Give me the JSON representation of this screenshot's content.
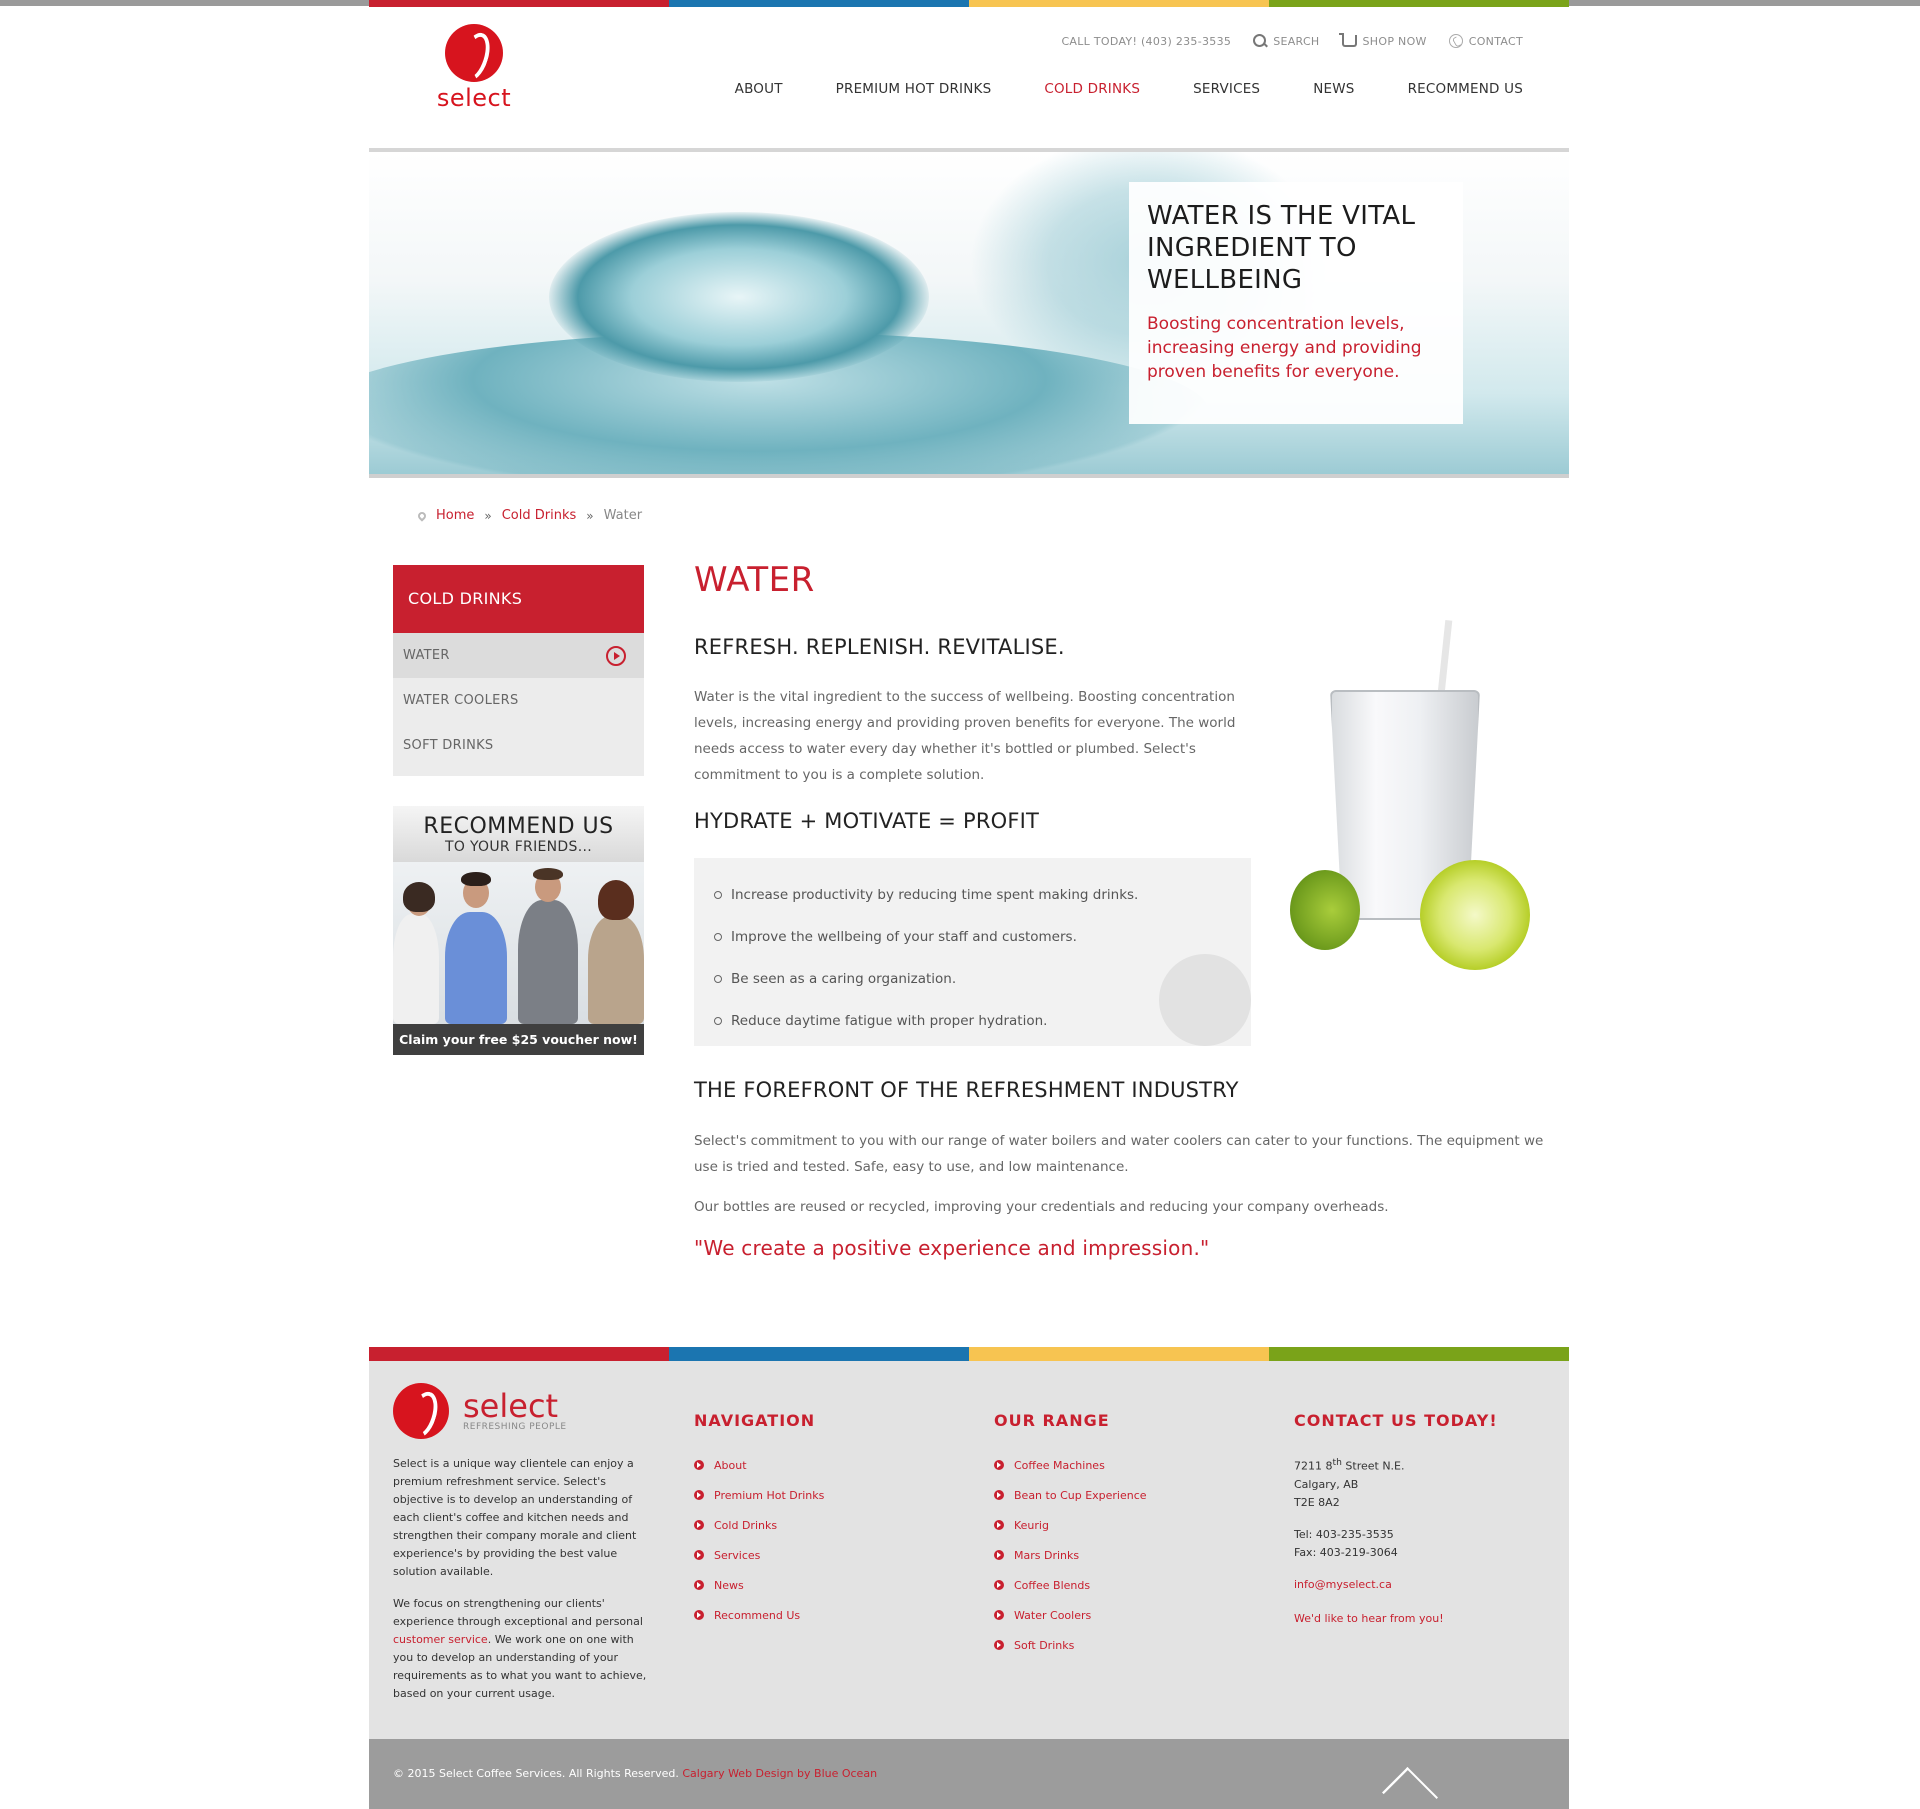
{
  "header": {
    "logo_text": "select",
    "utility": {
      "call": "CALL TODAY! (403) 235-3535",
      "search": "SEARCH",
      "shop": "SHOP NOW",
      "contact": "CONTACT"
    },
    "nav": [
      "ABOUT",
      "PREMIUM HOT DRINKS",
      "COLD DRINKS",
      "SERVICES",
      "NEWS",
      "RECOMMEND US"
    ],
    "active_nav": "COLD DRINKS"
  },
  "hero": {
    "title_line1": "WATER IS THE VITAL",
    "title_line2": "INGREDIENT TO",
    "title_line3": "WELLBEING",
    "sub_line1": "Boosting concentration levels,",
    "sub_line2": "increasing energy and providing",
    "sub_line3": "proven benefits for everyone."
  },
  "breadcrumb": {
    "home": "Home",
    "parent": "Cold Drinks",
    "current": "Water"
  },
  "sidebar": {
    "title": "COLD DRINKS",
    "items": [
      {
        "label": "WATER",
        "active": true
      },
      {
        "label": "WATER COOLERS",
        "active": false
      },
      {
        "label": "SOFT DRINKS",
        "active": false
      }
    ],
    "promo_title": "RECOMMEND US",
    "promo_sub": "TO YOUR FRIENDS...",
    "promo_cta": "Claim your free $25 voucher now!"
  },
  "content": {
    "title": "WATER",
    "h_refresh": "REFRESH. REPLENISH. REVITALISE.",
    "p1_l1": "Water is the vital ingredient to the success of wellbeing. Boosting concentration",
    "p1_l2": "levels, increasing energy and providing proven benefits for everyone. The world",
    "p1_l3": "needs access to water every day whether it's bottled or plumbed. Select's",
    "p1_l4": "commitment to you is a complete solution.",
    "h_hydrate": "HYDRATE + MOTIVATE = PROFIT",
    "benefits": [
      "Increase productivity by reducing time spent making drinks.",
      "Improve the wellbeing of your staff and customers.",
      "Be seen as a caring organization.",
      "Reduce daytime fatigue with proper hydration."
    ],
    "h_forefront": "THE FOREFRONT OF THE REFRESHMENT INDUSTRY",
    "p2_l1": "Select's commitment to you with our range of water boilers and water coolers can cater to your functions. The equipment we",
    "p2_l2": "use is tried and tested. Safe, easy to use, and low maintenance.",
    "p3": "Our bottles are reused or recycled, improving your credentials and reducing your company overheads.",
    "quote": "\"We create a positive experience and impression.\""
  },
  "footer": {
    "logo_text": "select",
    "tagline": "REFRESHING PEOPLE",
    "about_p1": "Select is a unique way clientele can enjoy a premium refreshment service. Select's objective is to develop an understanding of each client's coffee and kitchen needs and strengthen their company morale and client experience's by providing the best value solution available.",
    "about_p2_a": "We focus on strengthening our clients' experience through exceptional and personal",
    "about_p2_link": "customer service",
    "about_p2_b": ". We work one on one with you to develop an understanding of your requirements as to what you want to achieve, based on your current usage.",
    "nav_title": "NAVIGATION",
    "nav_items": [
      "About",
      "Premium Hot Drinks",
      "Cold Drinks",
      "Services",
      "News",
      "Recommend Us"
    ],
    "range_title": "OUR RANGE",
    "range_items": [
      "Coffee Machines",
      "Bean to Cup Experience",
      "Keurig",
      "Mars Drinks",
      "Coffee Blends",
      "Water Coolers",
      "Soft Drinks"
    ],
    "contact_title": "CONTACT US TODAY!",
    "addr1_a": "7211 8",
    "addr1_sup": "th",
    "addr1_b": " Street N.E.",
    "addr2": "Calgary, AB",
    "addr3": "T2E 8A2",
    "tel": "Tel: 403-235-3535",
    "fax": "Fax: 403-219-3064",
    "email": "info@myselect.ca",
    "hear": "We'd like to hear from you!",
    "copyright": "© 2015 Select Coffee Services. All Rights Reserved.",
    "credit": "Calgary Web Design by Blue Ocean"
  },
  "colors": {
    "brand_red": "#c8202f",
    "blue": "#1b75b0",
    "yellow": "#f7c451",
    "green": "#7aa319"
  }
}
